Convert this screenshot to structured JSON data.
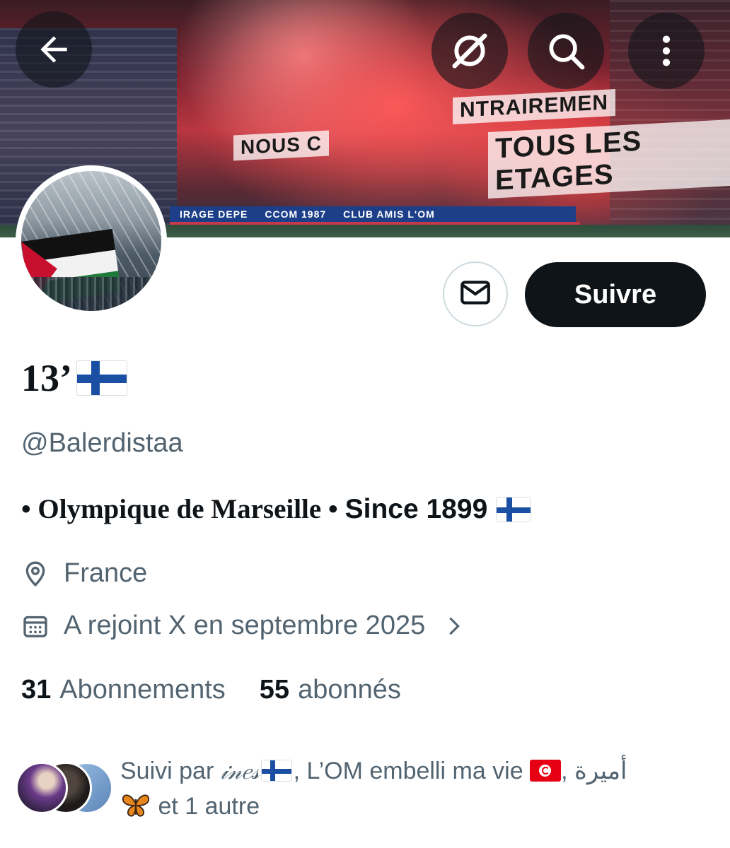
{
  "banner": {
    "tifo_line1": "NTRAIREMEN",
    "tifo_line2": "TOUS LES ETAGES",
    "tifo_line3": "NOUS C",
    "ad_items": [
      "IRAGE DEPE",
      "CCOM 1987",
      "CLUB AMIS L'OM"
    ]
  },
  "toolbar": {
    "back_icon": "arrow-left-icon",
    "grok_icon": "grok-icon",
    "search_icon": "search-icon",
    "more_icon": "more-vertical-icon"
  },
  "actions": {
    "message_icon": "envelope-icon",
    "follow_label": "Suivre"
  },
  "profile": {
    "display_name": "13’",
    "display_name_emoji": "flag-finland",
    "handle": "@Balerdistaa",
    "bio_part1": "• Olympique de Marseille •",
    "bio_part2": "Since 1899",
    "bio_emoji": "flag-finland",
    "location": "France",
    "joined": "A rejoint X en septembre 2025"
  },
  "stats": {
    "following_count": "31",
    "following_label": "Abonnements",
    "followers_count": "55",
    "followers_label": "abonnés"
  },
  "followed_by": {
    "prefix": "Suivi par",
    "user1": "𝒾𝓃𝑒𝓈",
    "separator1": ",",
    "user2": "L’OM embelli ma vie",
    "separator2": ",",
    "user3": "أميرة",
    "suffix": "et 1 autre"
  },
  "colors": {
    "primary_text": "#0f1419",
    "secondary_text": "#536471",
    "follow_button_bg": "#0f1419",
    "border": "#cfd9de"
  }
}
